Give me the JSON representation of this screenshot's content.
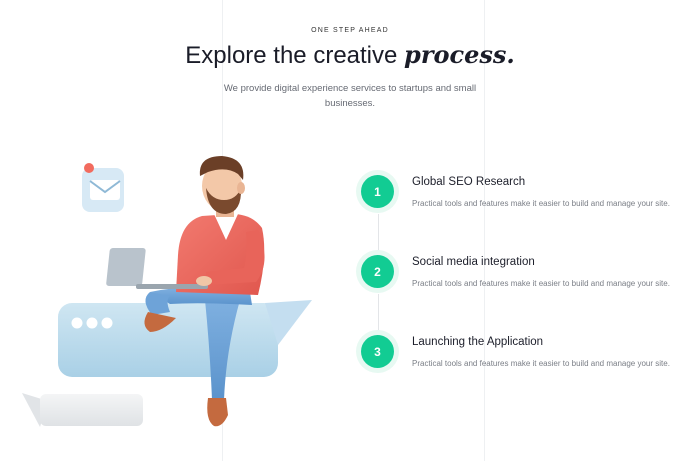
{
  "header": {
    "eyebrow": "ONE STEP AHEAD",
    "title_plain": "Explore the creative ",
    "title_emphasis": "process.",
    "subtitle": "We provide digital experience services to startups and small businesses."
  },
  "steps": [
    {
      "number": "1",
      "title": "Global SEO Research",
      "text": "Practical tools and features make it easier to build and manage your site."
    },
    {
      "number": "2",
      "title": "Social media integration",
      "text": "Practical tools and features make it easier to build and manage your site."
    },
    {
      "number": "3",
      "title": "Launching the Application",
      "text": "Practical tools and features make it easier to build and manage your site."
    }
  ],
  "colors": {
    "accent": "#12cc93",
    "title": "#1a1c28",
    "body_text": "#7a7e86"
  },
  "icons": [
    "mail-icon",
    "chat-bubble-icon",
    "person-laptop-illustration"
  ]
}
